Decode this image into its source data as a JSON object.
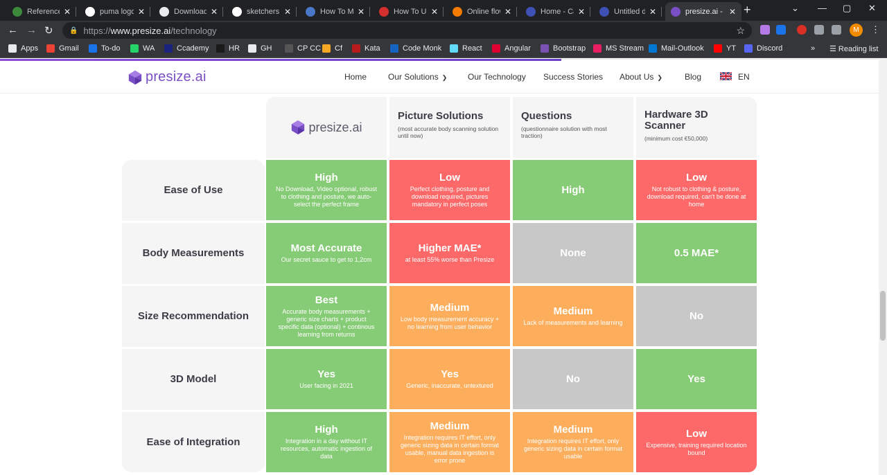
{
  "browser": {
    "tabs": [
      {
        "title": "References",
        "icon": "references-icon",
        "color": "#3c8a3c"
      },
      {
        "title": "puma logo",
        "icon": "google-icon",
        "color": "#ffffff"
      },
      {
        "title": "Downloads",
        "icon": "download-icon",
        "color": "#e8eaed"
      },
      {
        "title": "sketchers lo",
        "icon": "google-icon",
        "color": "#ffffff"
      },
      {
        "title": "How To Ma",
        "icon": "site-icon",
        "color": "#4a78c8"
      },
      {
        "title": "How To Use",
        "icon": "s-icon",
        "color": "#d32f2f"
      },
      {
        "title": "Online flow",
        "icon": "l-icon",
        "color": "#f57c00"
      },
      {
        "title": "Home - Can",
        "icon": "c-icon",
        "color": "#3f51b5"
      },
      {
        "title": "Untitled de",
        "icon": "c-icon",
        "color": "#3f51b5"
      },
      {
        "title": "presize.ai -",
        "icon": "presize-icon",
        "color": "#7a4fc5"
      }
    ],
    "url_prefix": "https://",
    "url_domain": "www.presize.ai",
    "url_path": "/technology",
    "bookmarks": [
      "Apps",
      "Gmail",
      "To-do",
      "WA",
      "Ccademy",
      "HR",
      "GH",
      "CP CC",
      "Cf",
      "Kata",
      "Code Monk",
      "React",
      "Angular",
      "Bootstrap",
      "MS Stream",
      "Mail-Outlook",
      "YT",
      "Discord"
    ],
    "reading_list": "Reading list",
    "profile_initial": "M"
  },
  "site": {
    "logo_text": "presize.ai",
    "nav": [
      "Home",
      "Our Solutions",
      "Our Technology",
      "Success Stories",
      "About Us",
      "Blog"
    ],
    "language": "EN"
  },
  "table": {
    "header_logo": "presize.ai",
    "columns": [
      {
        "title": "Picture Solutions",
        "subtitle": "(most accurate body scanning solution until now)"
      },
      {
        "title": "Questions",
        "subtitle": "(questionnaire solution with most traction)"
      },
      {
        "title": "Hardware 3D Scanner",
        "subtitle": "(minimum cost €50,000)"
      }
    ],
    "rows": [
      {
        "label": "Ease of Use",
        "cells": [
          {
            "value": "High",
            "note": "No Download, Video optional, robust to clothing and posture, we auto-select the perfect frame",
            "color": "green"
          },
          {
            "value": "Low",
            "note": "Perfect clothing, posture and download required, pictures mandatory in perfect poses",
            "color": "red"
          },
          {
            "value": "High",
            "note": "",
            "color": "green"
          },
          {
            "value": "Low",
            "note": "Not robust to clothing & posture, download required, can't be done at home",
            "color": "red"
          }
        ]
      },
      {
        "label": "Body Measurements",
        "cells": [
          {
            "value": "Most Accurate",
            "note": "Our secret sauce to get to 1,2cm",
            "color": "green"
          },
          {
            "value": "Higher MAE*",
            "note": "at least 55% worse than Presize",
            "color": "red"
          },
          {
            "value": "None",
            "note": "",
            "color": "grey"
          },
          {
            "value": "0.5 MAE*",
            "note": "",
            "color": "green"
          }
        ]
      },
      {
        "label": "Size Recommendation",
        "cells": [
          {
            "value": "Best",
            "note": "Accurate body measurements + generic size charts + product specific data (optional) + continous learning from returns",
            "color": "green"
          },
          {
            "value": "Medium",
            "note": "Low body measurement accuracy + no learning from user behavior",
            "color": "orange"
          },
          {
            "value": "Medium",
            "note": "Lack of measurements and learning",
            "color": "orange"
          },
          {
            "value": "No",
            "note": "",
            "color": "grey"
          }
        ]
      },
      {
        "label": "3D Model",
        "cells": [
          {
            "value": "Yes",
            "note": "User facing in 2021",
            "color": "green"
          },
          {
            "value": "Yes",
            "note": "Generic, inaccurate, untextured",
            "color": "orange"
          },
          {
            "value": "No",
            "note": "",
            "color": "grey"
          },
          {
            "value": "Yes",
            "note": "",
            "color": "green"
          }
        ]
      },
      {
        "label": "Ease of Integration",
        "cells": [
          {
            "value": "High",
            "note": "Integration in a day without IT resources, automatic ingestion of data",
            "color": "green"
          },
          {
            "value": "Medium",
            "note": "Integration requires IT effort, only generic sizing data in certain format usable, manual data ingestion is error prone",
            "color": "orange"
          },
          {
            "value": "Medium",
            "note": "Integration requires IT effort, only generic sizing data in certain format usable",
            "color": "orange"
          },
          {
            "value": "Low",
            "note": "Expensive, training required location bound",
            "color": "red"
          }
        ]
      }
    ]
  }
}
